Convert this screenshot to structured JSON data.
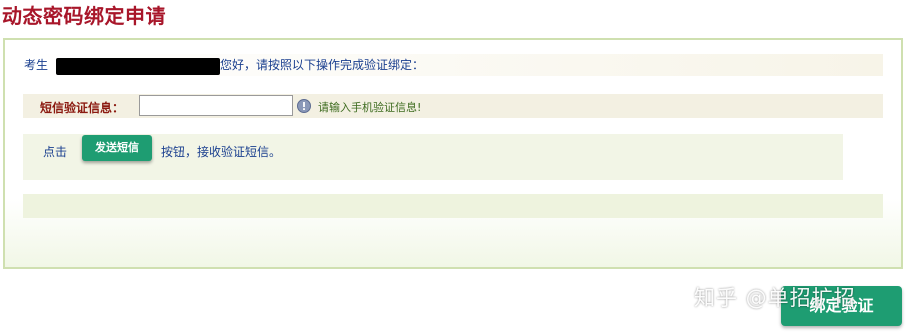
{
  "page": {
    "title": "动态密码绑定申请"
  },
  "greeting": {
    "prefix": "考生",
    "suffix": "您好，请按照以下操作完成验证绑定："
  },
  "sms_row": {
    "label": "短信验证信息：",
    "input_value": "",
    "hint": "请输入手机验证信息!"
  },
  "send_row": {
    "click_text": "点击",
    "send_button": "发送短信",
    "tail_text": "按钮，接收验证短信。"
  },
  "footer": {
    "bind_button": "绑定验证",
    "watermark": "知乎 @单招扩招"
  },
  "colors": {
    "title": "#a8162a",
    "button": "#1e9d72",
    "panel_border": "#cfe0b0"
  }
}
